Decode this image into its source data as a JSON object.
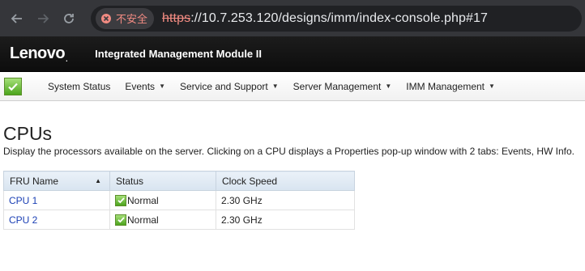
{
  "browser": {
    "insecure_label": "不安全",
    "url_scheme": "https",
    "url_rest": "://10.7.253.120/designs/imm/index-console.php#17"
  },
  "header": {
    "logo": "Lenovo",
    "product_title": "Integrated Management Module II"
  },
  "menu": {
    "items": [
      {
        "label": "System Status",
        "has_caret": false
      },
      {
        "label": "Events",
        "has_caret": true
      },
      {
        "label": "Service and Support",
        "has_caret": true
      },
      {
        "label": "Server Management",
        "has_caret": true
      },
      {
        "label": "IMM Management",
        "has_caret": true
      }
    ]
  },
  "page": {
    "title": "CPUs",
    "description": "Display the processors available on the server. Clicking on a CPU displays a Properties pop-up window with 2 tabs: Events, HW Info."
  },
  "table": {
    "headers": [
      "FRU Name",
      "Status",
      "Clock Speed"
    ],
    "rows": [
      {
        "name": "CPU 1",
        "status": "Normal",
        "clock": "2.30 GHz"
      },
      {
        "name": "CPU 2",
        "status": "Normal",
        "clock": "2.30 GHz"
      }
    ]
  },
  "colors": {
    "url_warning": "#f28b82",
    "header_bg": "#111111",
    "link": "#1a3fb4",
    "status_ok": "#4ca41c"
  }
}
